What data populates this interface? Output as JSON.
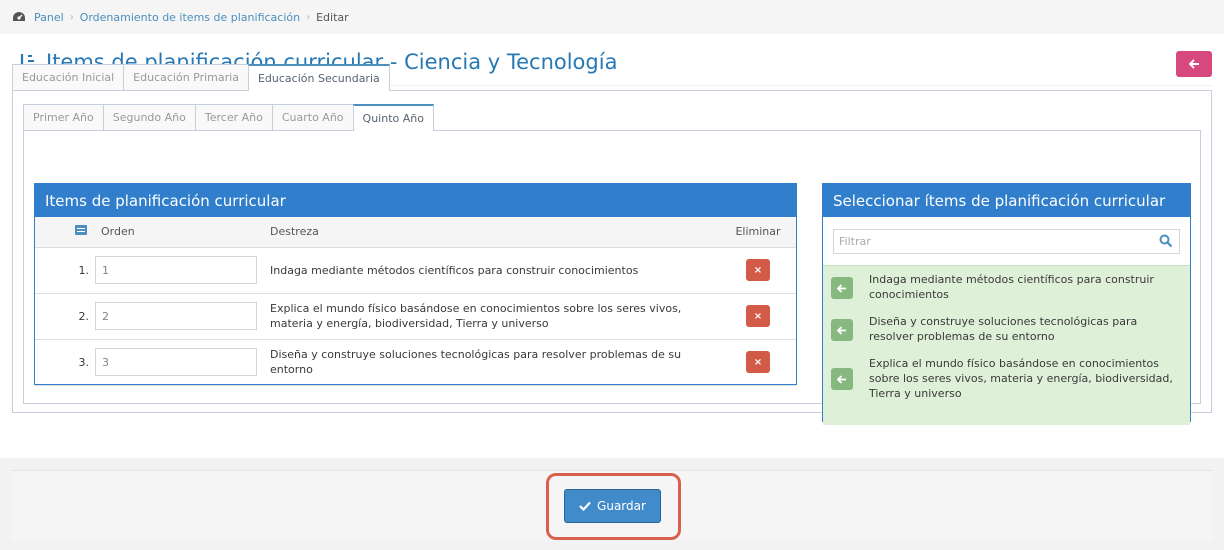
{
  "breadcrumb": {
    "panel": "Panel",
    "ordenamiento": "Ordenamiento de items de planificación",
    "current": "Editar"
  },
  "header": {
    "title": "Items de planificación curricular - Ciencia y Tecnología"
  },
  "outer_tabs": [
    "Educación Inicial",
    "Educación Primaria",
    "Educación Secundaria"
  ],
  "inner_tabs": [
    "Primer Año",
    "Segundo Año",
    "Tercer Año",
    "Cuarto Año",
    "Quinto Año"
  ],
  "items_panel": {
    "title": "Items de planificación curricular",
    "col_orden": "Orden",
    "col_destreza": "Destreza",
    "col_eliminar": "Eliminar",
    "rows": [
      {
        "num": "1.",
        "orden": "1",
        "destreza": "Indaga mediante métodos científicos para construir conocimientos"
      },
      {
        "num": "2.",
        "orden": "2",
        "destreza": "Explica el mundo físico basándose en conocimientos sobre los seres vivos, materia y energía, biodiversidad, Tierra y universo"
      },
      {
        "num": "3.",
        "orden": "3",
        "destreza": "Diseña y construye soluciones tecnológicas para resolver problemas de su entorno"
      }
    ],
    "delete_glyph": "×"
  },
  "select_panel": {
    "title": "Seleccionar ítems de planificación curricular",
    "filter_placeholder": "Filtrar",
    "items": [
      "Indaga mediante métodos científicos para construir conocimientos",
      "Diseña y construye soluciones tecnológicas para resolver problemas de su entorno",
      "Explica el mundo físico basándose en conocimientos sobre los seres vivos, materia y energía, biodiversidad, Tierra y universo"
    ]
  },
  "footer": {
    "save_label": "Guardar"
  },
  "colors": {
    "primary": "#307ecc",
    "title": "#2679b5",
    "back_button": "#d6487e",
    "delete": "#d15b47",
    "add": "#87b87f",
    "highlight": "#d9604c"
  }
}
